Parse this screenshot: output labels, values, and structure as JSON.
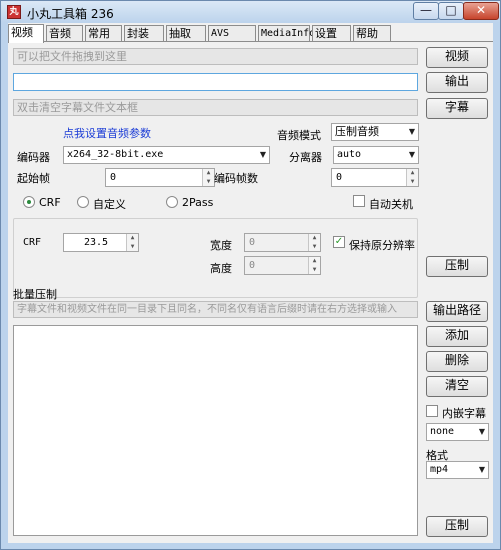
{
  "window": {
    "title": "小丸工具箱 236",
    "icon_name": "app-icon",
    "app_icon_glyph": "丸",
    "min_glyph": "—",
    "max_glyph": "□",
    "close_glyph": "✕"
  },
  "tabs": [
    "视频",
    "音频",
    "常用",
    "封装",
    "抽取",
    "AVS",
    "MediaInfo",
    "设置",
    "帮助"
  ],
  "active_tab": "视频",
  "video_input": {
    "placeholder": "可以把文件拖拽到这里",
    "button": "视频"
  },
  "output_field": {
    "value": "",
    "button": "输出"
  },
  "subtitle_input": {
    "placeholder": "双击清空字幕文件文本框",
    "button": "字幕"
  },
  "audio_params_link": "点我设置音频参数",
  "audio_mode": {
    "label": "音频模式",
    "value": "压制音频"
  },
  "encoder": {
    "label": "编码器",
    "value": "x264_32-8bit.exe"
  },
  "demuxer": {
    "label": "分离器",
    "value": "auto"
  },
  "start_frame": {
    "label": "起始帧",
    "value": "0"
  },
  "encode_frames": {
    "label": "编码帧数",
    "value": "0"
  },
  "rate_mode": {
    "options": [
      "CRF",
      "自定义",
      "2Pass"
    ],
    "selected": "CRF"
  },
  "auto_shutdown": {
    "label": "自动关机",
    "checked": false
  },
  "crf": {
    "label": "CRF",
    "value": "23.5"
  },
  "width": {
    "label": "宽度",
    "value": "0"
  },
  "height": {
    "label": "高度",
    "value": "0"
  },
  "keep_resolution": {
    "label": "保持原分辨率",
    "checked": true,
    "check_glyph": "✓"
  },
  "encode_button": "压制",
  "batch": {
    "title": "批量压制",
    "hint": "字幕文件和视频文件在同一目录下且同名，不同名仅有语言后缀时请在右方选择或输入",
    "buttons": {
      "output_path": "输出路径",
      "add": "添加",
      "delete": "删除",
      "clear": "清空"
    },
    "embed_subtitle": {
      "label": "内嵌字幕",
      "checked": false
    },
    "subtitle_lang": "none",
    "format_label": "格式",
    "format_value": "mp4",
    "encode_button": "压制"
  },
  "accent_colors": {
    "link": "#1a3bd6",
    "focus_border": "#5ea7df",
    "close_button": "#c7442c"
  }
}
